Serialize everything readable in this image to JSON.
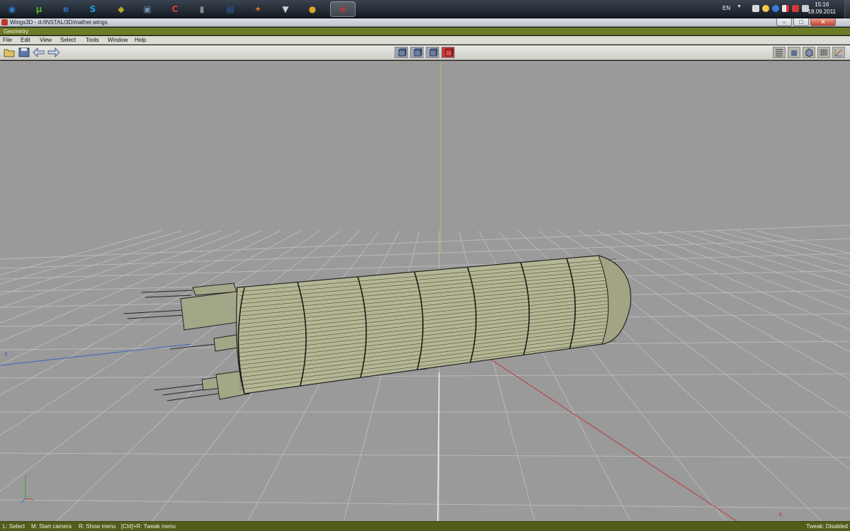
{
  "taskbar": {
    "pinned": [
      {
        "name": "windows-start-icon",
        "glyph": "◉",
        "color": "#2f7fd6"
      },
      {
        "name": "utorrent-icon",
        "glyph": "µ",
        "color": "#4caf2c"
      },
      {
        "name": "internet-explorer-icon",
        "glyph": "e",
        "color": "#2b6fc2"
      },
      {
        "name": "skype-icon",
        "glyph": "S",
        "color": "#1ea0e6"
      },
      {
        "name": "app-launcher-icon",
        "glyph": "◆",
        "color": "#b8a62a"
      },
      {
        "name": "file-utility-icon",
        "glyph": "▣",
        "color": "#6c8fb3"
      },
      {
        "name": "ccleaner-icon",
        "glyph": "C",
        "color": "#d7402b"
      },
      {
        "name": "speaker-app-icon",
        "glyph": "▮",
        "color": "#8b8b8b"
      },
      {
        "name": "floppy-save-icon",
        "glyph": "▤",
        "color": "#2c5fa8"
      },
      {
        "name": "game-app-icon",
        "glyph": "✦",
        "color": "#d86a2a"
      },
      {
        "name": "alien-app-icon",
        "glyph": "▼",
        "color": "#d0d0d0"
      },
      {
        "name": "chrome-icon",
        "glyph": "●",
        "color": "#e0a423"
      },
      {
        "name": "wings3d-task-icon",
        "glyph": "e",
        "color": "#c0392b"
      }
    ],
    "tray": {
      "language": "EN",
      "time": "15:16",
      "date": "18.09.2011"
    }
  },
  "window": {
    "title": "Wings3D - d:/INSTAL/3D/mather.wings",
    "min_label": "–",
    "max_label": "□",
    "close_label": "✕"
  },
  "geometry_header": "Geometry",
  "menu": {
    "items": [
      "File",
      "Edit",
      "View",
      "Select",
      "Tools",
      "Window",
      "Help"
    ]
  },
  "viewport": {
    "axis_z_label": "z",
    "corner_marker": "x"
  },
  "status": {
    "hint_left": "L: Select",
    "hint_middle": "M: Start camera",
    "hint_right": "R: Show menu",
    "hint_tweak": "[Ctrl]+R: Tweak menu",
    "tweak_state": "Tweak: Disabled"
  },
  "colors": {
    "viewport_bg": "#9a9a9a",
    "geometry_bar": "#6c7b26",
    "status_bar": "#525d1c",
    "mesh_fill": "#b7b99a",
    "y_axis": "#9bd04a",
    "x_axis": "#c23a3a",
    "z_axis": "#3a64c8"
  }
}
